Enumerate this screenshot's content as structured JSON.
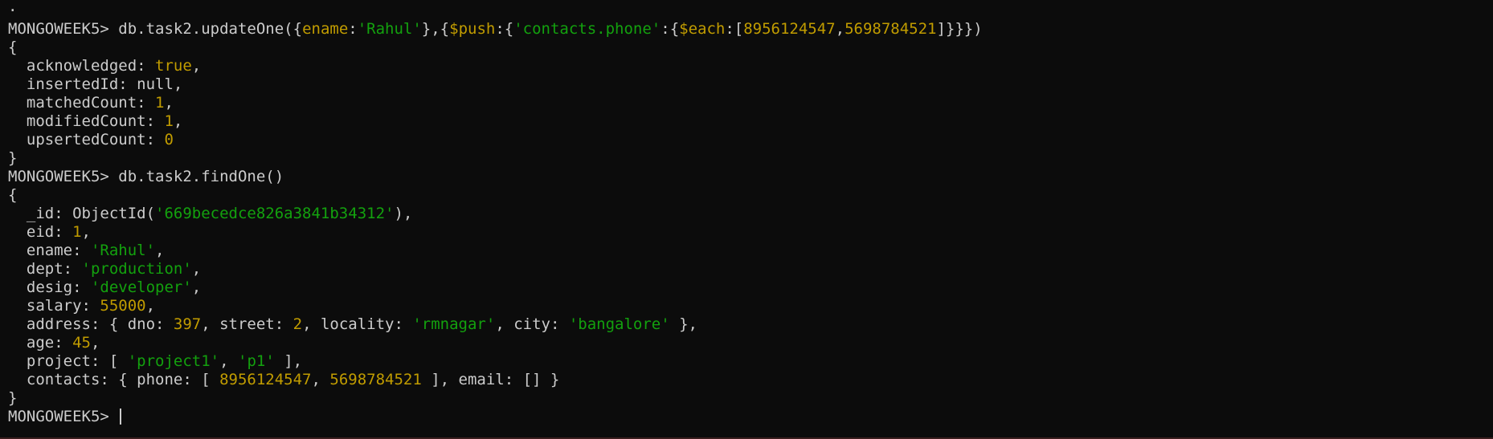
{
  "colors": {
    "background": "#0c0c0c",
    "text": "#cccccc",
    "string": "#13a10e",
    "number": "#c19c00"
  },
  "prompt": "MONGOWEEK5> ",
  "lines": [
    [
      {
        "t": "plain",
        "v": "·"
      }
    ],
    [
      {
        "t": "prompt",
        "v": "MONGOWEEK5> "
      },
      {
        "t": "plain",
        "v": "db.task2.updateOne({"
      },
      {
        "t": "kw",
        "v": "ename"
      },
      {
        "t": "plain",
        "v": ":"
      },
      {
        "t": "str",
        "v": "'Rahul'"
      },
      {
        "t": "plain",
        "v": "},{"
      },
      {
        "t": "kw",
        "v": "$push"
      },
      {
        "t": "plain",
        "v": ":{"
      },
      {
        "t": "str",
        "v": "'contacts.phone'"
      },
      {
        "t": "plain",
        "v": ":{"
      },
      {
        "t": "kw",
        "v": "$each"
      },
      {
        "t": "plain",
        "v": ":["
      },
      {
        "t": "num",
        "v": "8956124547"
      },
      {
        "t": "plain",
        "v": ","
      },
      {
        "t": "num",
        "v": "5698784521"
      },
      {
        "t": "plain",
        "v": "]}}})"
      }
    ],
    [
      {
        "t": "plain",
        "v": "{"
      }
    ],
    [
      {
        "t": "plain",
        "v": "  acknowledged: "
      },
      {
        "t": "num",
        "v": "true"
      },
      {
        "t": "plain",
        "v": ","
      }
    ],
    [
      {
        "t": "plain",
        "v": "  insertedId: null,"
      }
    ],
    [
      {
        "t": "plain",
        "v": "  matchedCount: "
      },
      {
        "t": "num",
        "v": "1"
      },
      {
        "t": "plain",
        "v": ","
      }
    ],
    [
      {
        "t": "plain",
        "v": "  modifiedCount: "
      },
      {
        "t": "num",
        "v": "1"
      },
      {
        "t": "plain",
        "v": ","
      }
    ],
    [
      {
        "t": "plain",
        "v": "  upsertedCount: "
      },
      {
        "t": "num",
        "v": "0"
      }
    ],
    [
      {
        "t": "plain",
        "v": "}"
      }
    ],
    [
      {
        "t": "prompt",
        "v": "MONGOWEEK5> "
      },
      {
        "t": "plain",
        "v": "db.task2.findOne()"
      }
    ],
    [
      {
        "t": "plain",
        "v": "{"
      }
    ],
    [
      {
        "t": "plain",
        "v": "  _id: ObjectId("
      },
      {
        "t": "str",
        "v": "'669becedce826a3841b34312'"
      },
      {
        "t": "plain",
        "v": "),"
      }
    ],
    [
      {
        "t": "plain",
        "v": "  eid: "
      },
      {
        "t": "num",
        "v": "1"
      },
      {
        "t": "plain",
        "v": ","
      }
    ],
    [
      {
        "t": "plain",
        "v": "  ename: "
      },
      {
        "t": "str",
        "v": "'Rahul'"
      },
      {
        "t": "plain",
        "v": ","
      }
    ],
    [
      {
        "t": "plain",
        "v": "  dept: "
      },
      {
        "t": "str",
        "v": "'production'"
      },
      {
        "t": "plain",
        "v": ","
      }
    ],
    [
      {
        "t": "plain",
        "v": "  desig: "
      },
      {
        "t": "str",
        "v": "'developer'"
      },
      {
        "t": "plain",
        "v": ","
      }
    ],
    [
      {
        "t": "plain",
        "v": "  salary: "
      },
      {
        "t": "num",
        "v": "55000"
      },
      {
        "t": "plain",
        "v": ","
      }
    ],
    [
      {
        "t": "plain",
        "v": "  address: { dno: "
      },
      {
        "t": "num",
        "v": "397"
      },
      {
        "t": "plain",
        "v": ", street: "
      },
      {
        "t": "num",
        "v": "2"
      },
      {
        "t": "plain",
        "v": ", locality: "
      },
      {
        "t": "str",
        "v": "'rmnagar'"
      },
      {
        "t": "plain",
        "v": ", city: "
      },
      {
        "t": "str",
        "v": "'bangalore'"
      },
      {
        "t": "plain",
        "v": " },"
      }
    ],
    [
      {
        "t": "plain",
        "v": "  age: "
      },
      {
        "t": "num",
        "v": "45"
      },
      {
        "t": "plain",
        "v": ","
      }
    ],
    [
      {
        "t": "plain",
        "v": "  project: [ "
      },
      {
        "t": "str",
        "v": "'project1'"
      },
      {
        "t": "plain",
        "v": ", "
      },
      {
        "t": "str",
        "v": "'p1'"
      },
      {
        "t": "plain",
        "v": " ],"
      }
    ],
    [
      {
        "t": "plain",
        "v": "  contacts: { phone: [ "
      },
      {
        "t": "num",
        "v": "8956124547"
      },
      {
        "t": "plain",
        "v": ", "
      },
      {
        "t": "num",
        "v": "5698784521"
      },
      {
        "t": "plain",
        "v": " ], email: [] }"
      }
    ],
    [
      {
        "t": "plain",
        "v": "}"
      }
    ]
  ],
  "active_prompt": "MONGOWEEK5> "
}
